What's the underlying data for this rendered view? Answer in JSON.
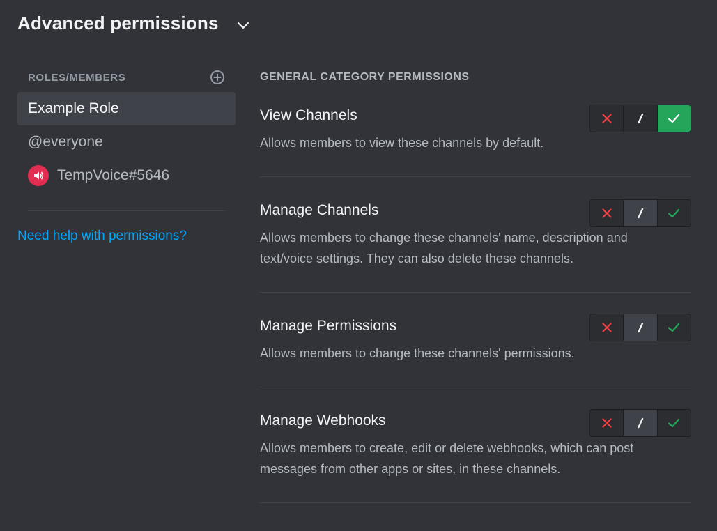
{
  "header": {
    "title": "Advanced permissions"
  },
  "sidebar": {
    "heading": "ROLES/MEMBERS",
    "items": [
      {
        "label": "Example Role",
        "selected": true
      },
      {
        "label": "@everyone",
        "selected": false
      },
      {
        "label": "TempVoice#5646",
        "selected": false,
        "avatar_color": "#e12d50"
      }
    ],
    "help_link": "Need help with permissions?"
  },
  "main": {
    "section_title": "GENERAL CATEGORY PERMISSIONS",
    "permissions": [
      {
        "name": "View Channels",
        "description": "Allows members to view these channels by default.",
        "state": "allow"
      },
      {
        "name": "Manage Channels",
        "description": "Allows members to change these channels' name, description and text/voice settings. They can also delete these channels.",
        "state": "neutral"
      },
      {
        "name": "Manage Permissions",
        "description": "Allows members to change these channels' permissions.",
        "state": "neutral"
      },
      {
        "name": "Manage Webhooks",
        "description": "Allows members to create, edit or delete webhooks, which can post messages from other apps or sites, in these channels.",
        "state": "neutral"
      }
    ]
  },
  "colors": {
    "background": "#313338",
    "deny": "#f23f43",
    "allow": "#23a55a",
    "link": "#00a8fc"
  }
}
